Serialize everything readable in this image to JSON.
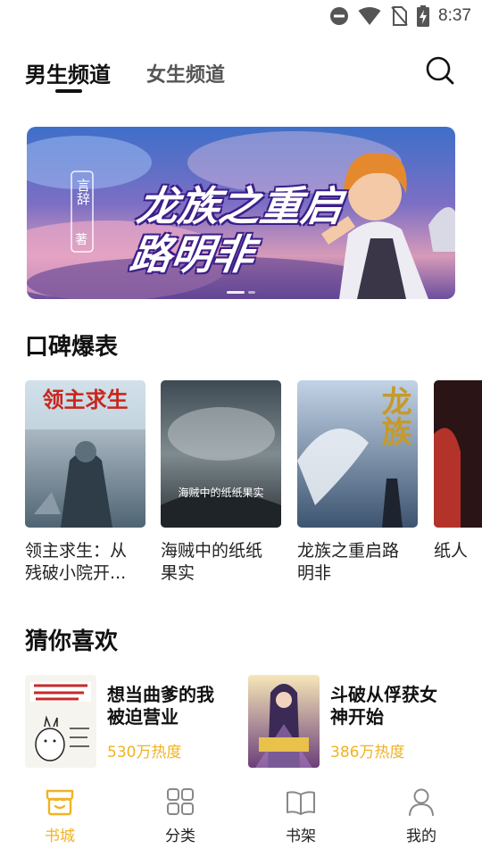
{
  "status_bar": {
    "time": "8:37",
    "icons": [
      "do-not-disturb-icon",
      "wifi-icon",
      "no-sim-icon",
      "battery-charging-icon"
    ]
  },
  "header": {
    "tabs": [
      {
        "label": "男生频道",
        "active": true
      },
      {
        "label": "女生频道",
        "active": false
      }
    ],
    "search_icon": "search-icon"
  },
  "banner": {
    "title": "龙族之重启路明非",
    "author_text": "言辞",
    "author_suffix": "著",
    "page_count": 2,
    "active_page": 0
  },
  "section_reputation": {
    "title": "口碑爆表",
    "books": [
      {
        "title": "领主求生：从残破小院开...",
        "cover_text": "领主求生"
      },
      {
        "title": "海贼中的纸纸果实",
        "cover_text": "海贼中的纸纸果实"
      },
      {
        "title": "龙族之重启路明非",
        "cover_text": "龙族"
      },
      {
        "title": "纸人",
        "cover_text": ""
      }
    ]
  },
  "section_guess": {
    "title": "猜你喜欢",
    "items": [
      {
        "title": "想当曲爹的我被迫营业",
        "heat": "530万热度"
      },
      {
        "title": "斗破从俘获女神开始",
        "heat": "386万热度"
      }
    ]
  },
  "bottom_nav": {
    "items": [
      {
        "label": "书城",
        "icon": "bookstore-icon",
        "active": true
      },
      {
        "label": "分类",
        "icon": "category-grid-icon",
        "active": false
      },
      {
        "label": "书架",
        "icon": "bookshelf-icon",
        "active": false
      },
      {
        "label": "我的",
        "icon": "profile-icon",
        "active": false
      }
    ]
  },
  "colors": {
    "accent": "#f0b321",
    "text_primary": "#111111",
    "text_secondary": "#555555"
  }
}
